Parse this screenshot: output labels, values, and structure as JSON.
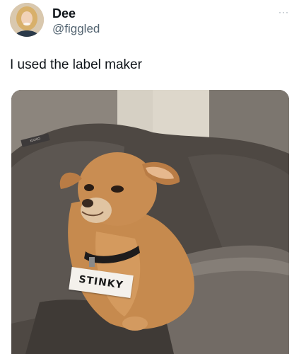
{
  "user": {
    "display_name": "Dee",
    "handle": "@figgled"
  },
  "post": {
    "text": "I used the label maker",
    "more_icon_glyph": "···"
  },
  "photo": {
    "label_text": "STINKY",
    "bed_tag_text": "KAMO"
  },
  "colors": {
    "text_primary": "#0f1419",
    "text_secondary": "#536471",
    "dog_fur": "#c68a4e"
  },
  "icons": {
    "more": "more-options-icon"
  }
}
